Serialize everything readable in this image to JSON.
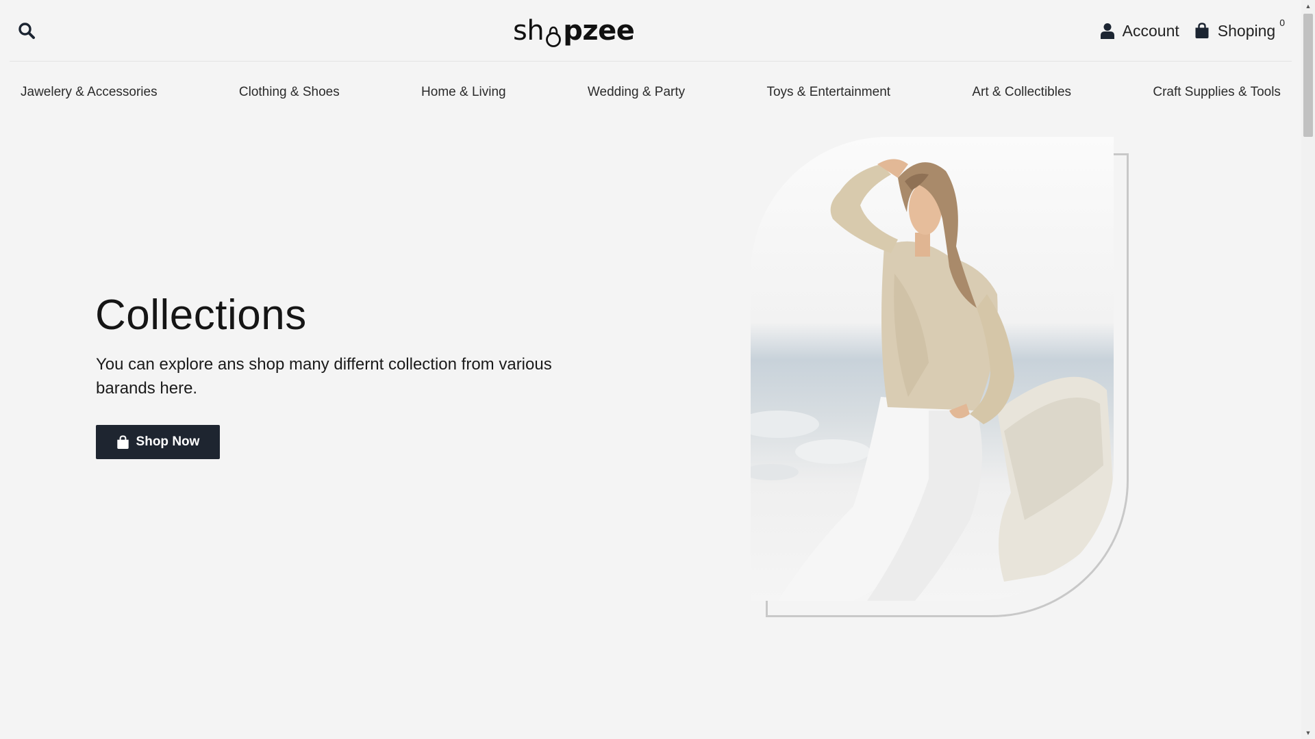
{
  "header": {
    "logo_text_left": "sh",
    "logo_text_right": "pzee",
    "account_label": "Account",
    "cart_label": "Shoping",
    "cart_count": "0"
  },
  "nav": {
    "items": [
      {
        "label": "Jawelery & Accessories"
      },
      {
        "label": "Clothing & Shoes"
      },
      {
        "label": "Home & Living"
      },
      {
        "label": "Wedding & Party"
      },
      {
        "label": "Toys & Entertainment"
      },
      {
        "label": "Art & Collectibles"
      },
      {
        "label": "Craft Supplies & Tools"
      }
    ]
  },
  "hero": {
    "title": "Collections",
    "text": "You can explore ans shop many differnt collection from various barands here.",
    "button_label": "Shop Now"
  },
  "icons": {
    "search": "search-icon",
    "account": "user-icon",
    "cart": "shopping-bag-icon",
    "button": "shopping-bag-icon"
  },
  "colors": {
    "background": "#f4f4f4",
    "button_bg": "#1e2530",
    "button_text": "#ffffff",
    "frame": "#c8c8c8"
  }
}
